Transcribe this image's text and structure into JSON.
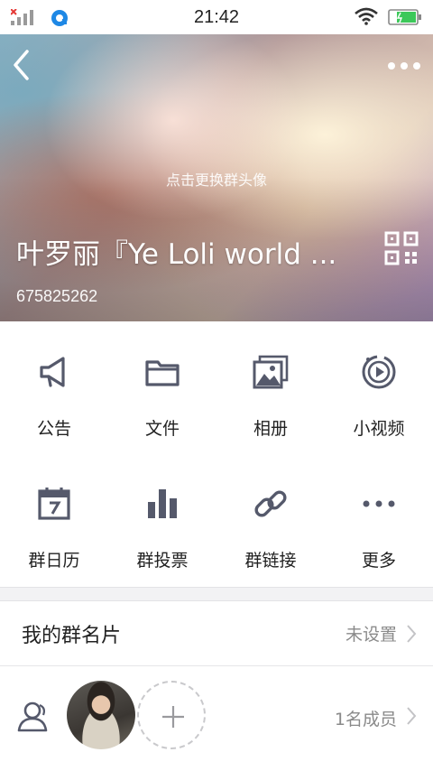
{
  "status_bar": {
    "time": "21:42"
  },
  "header": {
    "change_avatar_hint": "点击更换群头像",
    "group_name": "叶罗丽『Ye Loli world ...",
    "group_id": "675825262"
  },
  "features": [
    {
      "label": "公告",
      "icon": "megaphone-icon"
    },
    {
      "label": "文件",
      "icon": "folder-icon"
    },
    {
      "label": "相册",
      "icon": "photo-album-icon"
    },
    {
      "label": "小视频",
      "icon": "video-play-icon"
    },
    {
      "label": "群日历",
      "icon": "calendar-icon"
    },
    {
      "label": "群投票",
      "icon": "bar-chart-icon"
    },
    {
      "label": "群链接",
      "icon": "link-icon"
    },
    {
      "label": "更多",
      "icon": "more-dots-icon"
    }
  ],
  "card": {
    "label": "我的群名片",
    "value": "未设置"
  },
  "members": {
    "count_label": "1名成员"
  },
  "colors": {
    "icon_gray": "#55596b",
    "secondary_text": "#8a8a8a",
    "divider": "#e6e6e8"
  }
}
